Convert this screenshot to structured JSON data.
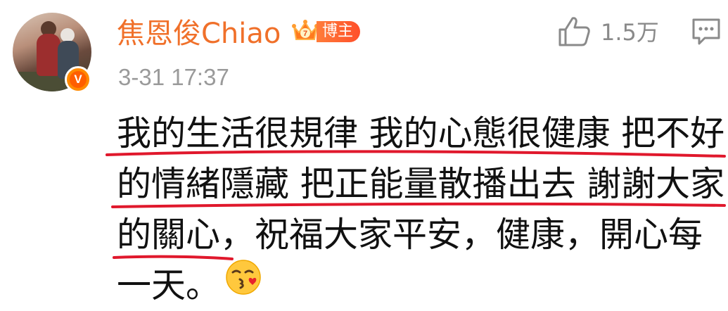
{
  "post": {
    "username": "焦恩俊Chiao",
    "badge_label": "博主",
    "badge_level": "7",
    "verified_mark": "V",
    "timestamp": "3-31 17:37",
    "like_count": "1.5万",
    "content_lines": [
      "我的生活很規律 我的心態很健康 把不好",
      "的情緒隱藏 把正能量散播出去 謝謝大家",
      "的關心，祝福大家平安，健康，開心每",
      "一天。"
    ]
  },
  "icons": {
    "like": "thumbs-up-icon",
    "comment": "comment-icon",
    "emoji": "kiss-face-emoji",
    "badge": "crown-icon",
    "verified": "verified-v-icon"
  },
  "colors": {
    "username": "#f0702a",
    "timestamp": "#9a9a9a",
    "underline": "#e0182c",
    "verified_badge": "#ff8a00"
  }
}
